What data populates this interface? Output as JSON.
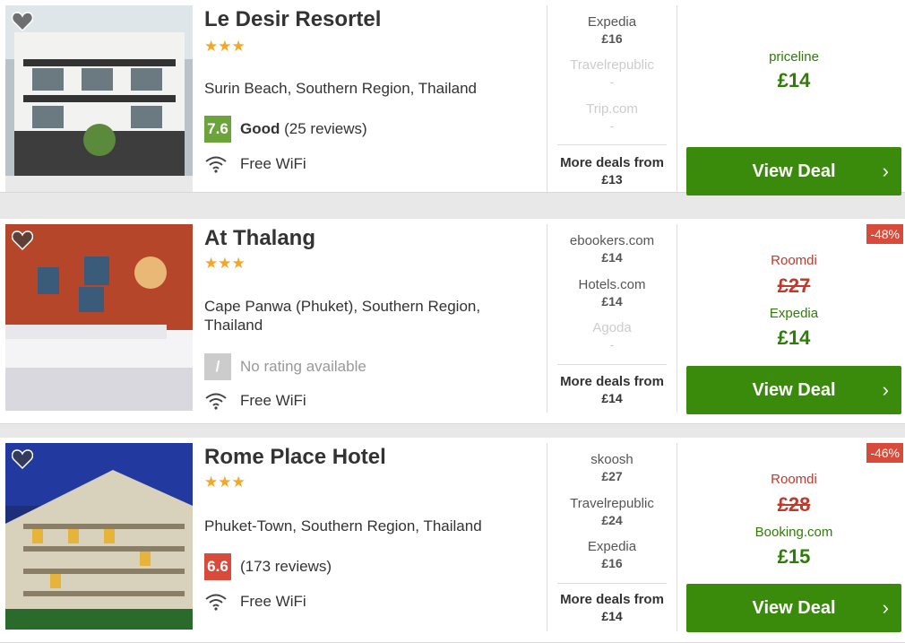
{
  "hotels": [
    {
      "name": "Le Desir Resortel",
      "stars": "★★★",
      "location": "Surin Beach, Southern Region, Thailand",
      "rating": {
        "score": "7.6",
        "label": "Good",
        "reviews": "(25 reviews)",
        "color": "#6aa43a"
      },
      "amenity": "Free WiFi",
      "deals": [
        {
          "provider": "Expedia",
          "price": "£16"
        },
        {
          "provider": "Travelrepublic",
          "price": "-"
        },
        {
          "provider": "Trip.com",
          "price": "-"
        }
      ],
      "more": {
        "label": "More deals from",
        "price": "£13"
      },
      "best": {
        "discount": "",
        "old_provider": "",
        "old_price": "",
        "provider": "priceline",
        "price": "£14"
      },
      "button": {
        "label": "View Deal",
        "chevron": "›"
      }
    },
    {
      "name": "At Thalang",
      "stars": "★★★",
      "location": "Cape Panwa (Phuket), Southern Region, Thailand",
      "rating": {
        "score": "/",
        "label": "",
        "reviews": "No rating available",
        "color": "#cccccc"
      },
      "amenity": "Free WiFi",
      "deals": [
        {
          "provider": "ebookers.com",
          "price": "£14"
        },
        {
          "provider": "Hotels.com",
          "price": "£14"
        },
        {
          "provider": "Agoda",
          "price": "-"
        }
      ],
      "more": {
        "label": "More deals from",
        "price": "£14"
      },
      "best": {
        "discount": "-48%",
        "old_provider": "Roomdi",
        "old_price": "£27",
        "provider": "Expedia",
        "price": "£14"
      },
      "button": {
        "label": "View Deal",
        "chevron": "›"
      }
    },
    {
      "name": "Rome Place Hotel",
      "stars": "★★★",
      "location": "Phuket-Town, Southern Region, Thailand",
      "rating": {
        "score": "6.6",
        "label": "",
        "reviews": "(173 reviews)",
        "color": "#d84b3a"
      },
      "amenity": "Free WiFi",
      "deals": [
        {
          "provider": "skoosh",
          "price": "£27"
        },
        {
          "provider": "Travelrepublic",
          "price": "£24"
        },
        {
          "provider": "Expedia",
          "price": "£16"
        }
      ],
      "more": {
        "label": "More deals from",
        "price": "£14"
      },
      "best": {
        "discount": "-46%",
        "old_provider": "Roomdi",
        "old_price": "£28",
        "provider": "Booking.com",
        "price": "£15"
      },
      "button": {
        "label": "View Deal",
        "chevron": "›"
      }
    }
  ],
  "colors": {
    "accent_green": "#3a8a0c",
    "price_green": "#2f7c07",
    "discount_red": "#d84b3a",
    "star": "#f5a623"
  }
}
